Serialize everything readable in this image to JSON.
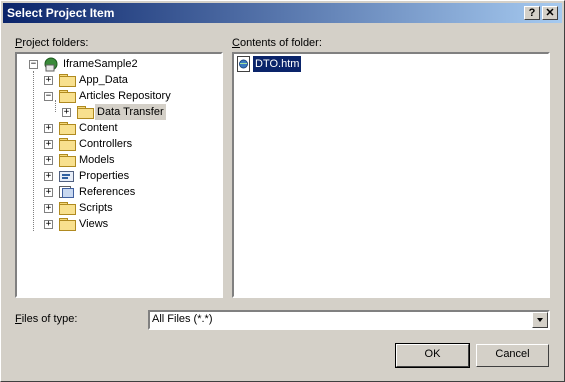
{
  "window": {
    "title": "Select Project Item",
    "help_label": "?",
    "close_label": "✕"
  },
  "project_folders": {
    "label": "Project folders:",
    "tree": [
      {
        "label": "IframeSample2",
        "icon": "project-icon"
      },
      {
        "label": "App_Data",
        "icon": "folder-icon"
      },
      {
        "label": "Articles Repository",
        "icon": "folder-icon"
      },
      {
        "label": "Data Transfer",
        "icon": "folder-icon",
        "selected": true
      },
      {
        "label": "Content",
        "icon": "folder-icon"
      },
      {
        "label": "Controllers",
        "icon": "folder-icon"
      },
      {
        "label": "Models",
        "icon": "folder-icon"
      },
      {
        "label": "Properties",
        "icon": "properties-icon"
      },
      {
        "label": "References",
        "icon": "references-icon"
      },
      {
        "label": "Scripts",
        "icon": "folder-icon"
      },
      {
        "label": "Views",
        "icon": "folder-icon"
      }
    ]
  },
  "contents": {
    "label": "Contents of folder:",
    "files": [
      {
        "name": "DTO.htm",
        "icon": "html-file-icon",
        "selected": true
      }
    ]
  },
  "file_type": {
    "label": "Files of type:",
    "value": "All Files (*.*)"
  },
  "buttons": {
    "ok": "OK",
    "cancel": "Cancel"
  },
  "colors": {
    "title_start": "#0a246a",
    "title_end": "#a6caf0",
    "selection": "#0a246a",
    "face": "#d4d0c8"
  }
}
